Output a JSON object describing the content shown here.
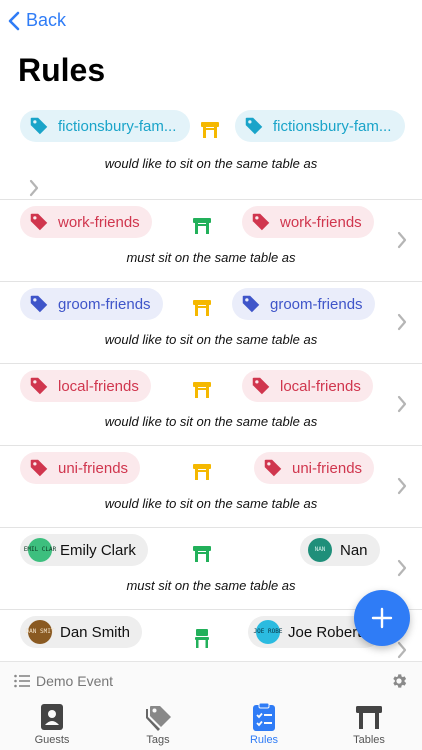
{
  "nav": {
    "back_label": "Back"
  },
  "page": {
    "title": "Rules"
  },
  "rules": [
    {
      "left": "fictionsbury-fam...",
      "right": "fictionsbury-fam...",
      "caption": "would like to sit on the same table as"
    },
    {
      "left": "work-friends",
      "right": "work-friends",
      "caption": "must sit on the same table as"
    },
    {
      "left": "groom-friends",
      "right": "groom-friends",
      "caption": "would like to sit on the same table as"
    },
    {
      "left": "local-friends",
      "right": "local-friends",
      "caption": "would like to sit on the same table as"
    },
    {
      "left": "uni-friends",
      "right": "uni-friends",
      "caption": "would like to sit on the same table as"
    },
    {
      "left": "Emily Clark",
      "left_initials": "EMIL CLAR",
      "right": "Nan",
      "right_initials": "NAN",
      "caption": "must sit on the same table as"
    },
    {
      "left": "Dan Smith",
      "left_initials": "DAN SMIT",
      "right": "Joe Roberts",
      "right_initials": "JOE ROBE",
      "caption": ""
    }
  ],
  "colors": {
    "accent": "#2f7cf6",
    "teal": "#1aa4c9",
    "red": "#d0364e",
    "indigo": "#3f55c9",
    "yellow": "#f5b800",
    "green": "#22b05a"
  },
  "event_bar": {
    "label": "Demo Event"
  },
  "tabs": [
    {
      "label": "Guests",
      "icon": "contact-card-icon"
    },
    {
      "label": "Tags",
      "icon": "tags-icon"
    },
    {
      "label": "Rules",
      "icon": "clipboard-checklist-icon"
    },
    {
      "label": "Tables",
      "icon": "table-icon"
    }
  ]
}
